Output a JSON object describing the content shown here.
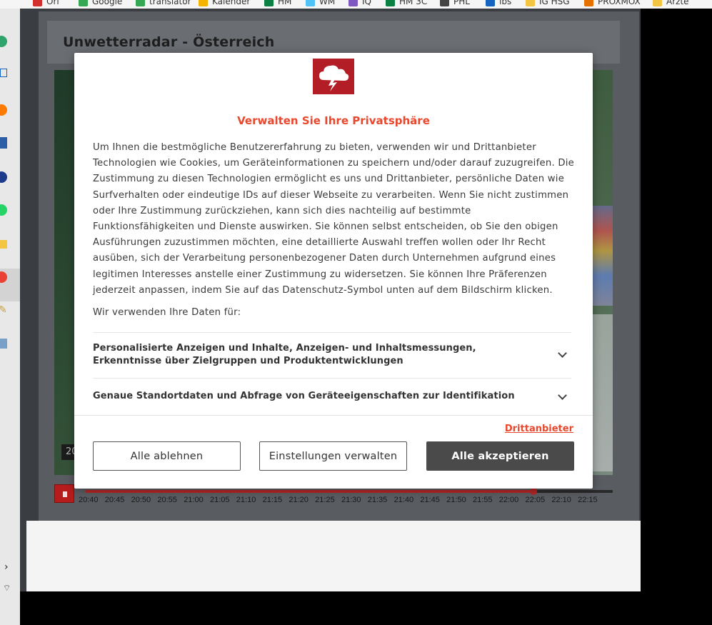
{
  "bookmarks": [
    {
      "label": "Ori",
      "color": "#d32f2f"
    },
    {
      "label": "Google",
      "color": "#34a853"
    },
    {
      "label": "translator",
      "color": "#34a853"
    },
    {
      "label": "Kalender",
      "color": "#f4b400"
    },
    {
      "label": "HM",
      "color": "#0b8043"
    },
    {
      "label": "WM",
      "color": "#4fc3f7"
    },
    {
      "label": "IQ",
      "color": "#7e57c2"
    },
    {
      "label": "HM 3C",
      "color": "#0b8043"
    },
    {
      "label": "PHL",
      "color": "#444444"
    },
    {
      "label": "lbs",
      "color": "#1565c0"
    },
    {
      "label": "IG HSG",
      "color": "#f4c542"
    },
    {
      "label": "PROXMOX",
      "color": "#e57200"
    },
    {
      "label": "Ärzte",
      "color": "#f4c542"
    }
  ],
  "widget": {
    "title": "Unwetterradar - Österreich"
  },
  "timeline": {
    "ticks": [
      "20:40",
      "20:45",
      "20:50",
      "20:55",
      "21:00",
      "21:05",
      "21:10",
      "21:15",
      "21:20",
      "21:25",
      "21:30",
      "21:35",
      "21:40",
      "21:45",
      "21:50",
      "21:55",
      "22:00",
      "22:05",
      "22:10",
      "22:15"
    ],
    "progress_fraction": 0.85,
    "partial_label": "20"
  },
  "consent": {
    "title": "Verwalten Sie Ihre Privatsphäre",
    "body": "Um Ihnen die bestmögliche Benutzererfahrung zu bieten, verwenden wir und Drittanbieter Technologien wie Cookies, um Geräteinformationen zu speichern und/oder darauf zuzugreifen. Die Zustimmung zu diesen Technologien ermöglicht es uns und Drittanbieter, persönliche Daten wie Surfverhalten oder eindeutige IDs auf dieser Webseite zu verarbeiten. Wenn Sie nicht zustimmen oder Ihre Zustimmung zurückziehen, kann sich dies nachteilig auf bestimmte Funktionsfähigkeiten und Dienste auswirken. Sie können selbst entscheiden, ob Sie den obigen Ausführungen zuzustimmen möchten, eine detaillierte Auswahl treffen wollen oder Ihr Recht ausüben, sich der Verarbeitung personenbezogener Daten durch Unternehmen aufgrund eines legitimen Interesses anstelle einer Zustimmung zu widersetzen. Sie können Ihre Präferenzen jederzeit anpassen, indem Sie auf das Datenschutz-Symbol unten auf dem Bildschirm klicken.",
    "use_heading": "Wir verwenden Ihre Daten für:",
    "purposes": [
      "Personalisierte Anzeigen und Inhalte, Anzeigen- und Inhaltsmessungen, Erkenntnisse über Zielgruppen und Produktentwicklungen",
      "Genaue Standortdaten und Abfrage von Geräteeigenschaften zur Identifikation"
    ],
    "vendors_link": "Drittanbieter",
    "reject_label": "Alle ablehnen",
    "manage_label": "Einstellungen verwalten",
    "accept_label": "Alle akzeptieren",
    "accent_color": "#e8482d"
  }
}
